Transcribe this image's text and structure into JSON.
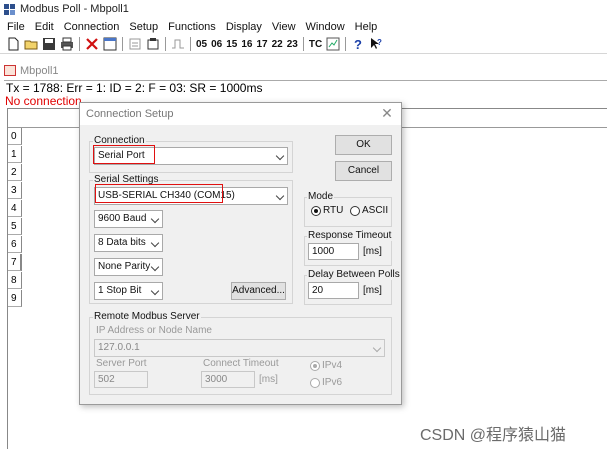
{
  "window": {
    "title": "Modbus Poll - Mbpoll1"
  },
  "menu": [
    "File",
    "Edit",
    "Connection",
    "Setup",
    "Functions",
    "Display",
    "View",
    "Window",
    "Help"
  ],
  "toolbar": {
    "function_codes": [
      "05",
      "06",
      "15",
      "16",
      "17",
      "22",
      "23"
    ],
    "tc_label": "TC"
  },
  "child": {
    "title": "Mbpoll1",
    "status": "Tx = 1788: Err = 1: ID = 2: F = 03: SR = 1000ms",
    "error": "No connection",
    "row_numbers": [
      "0",
      "1",
      "2",
      "3",
      "4",
      "5",
      "6",
      "7",
      "8",
      "9"
    ]
  },
  "dialog": {
    "title": "Connection Setup",
    "connection": {
      "label": "Connection",
      "value": "Serial Port"
    },
    "serial": {
      "label": "Serial Settings",
      "port": "USB-SERIAL CH340 (COM15)",
      "baud": "9600 Baud",
      "data_bits": "8 Data bits",
      "parity": "None Parity",
      "stop_bits": "1 Stop Bit",
      "advanced_label": "Advanced..."
    },
    "ok_label": "OK",
    "cancel_label": "Cancel",
    "mode": {
      "label": "Mode",
      "options": [
        "RTU",
        "ASCII"
      ],
      "selected": "RTU"
    },
    "response_timeout": {
      "label": "Response Timeout",
      "value": "1000",
      "unit": "[ms]"
    },
    "delay_polls": {
      "label": "Delay Between Polls",
      "value": "20",
      "unit": "[ms]"
    },
    "remote": {
      "label": "Remote Modbus Server",
      "ip_label": "IP Address or Node Name",
      "ip_value": "127.0.0.1",
      "port_label": "Server Port",
      "port_value": "502",
      "timeout_label": "Connect Timeout",
      "timeout_value": "3000",
      "timeout_unit": "[ms]",
      "ipv4": "IPv4",
      "ipv6": "IPv6"
    }
  },
  "watermark": "CSDN @程序猿山猫"
}
